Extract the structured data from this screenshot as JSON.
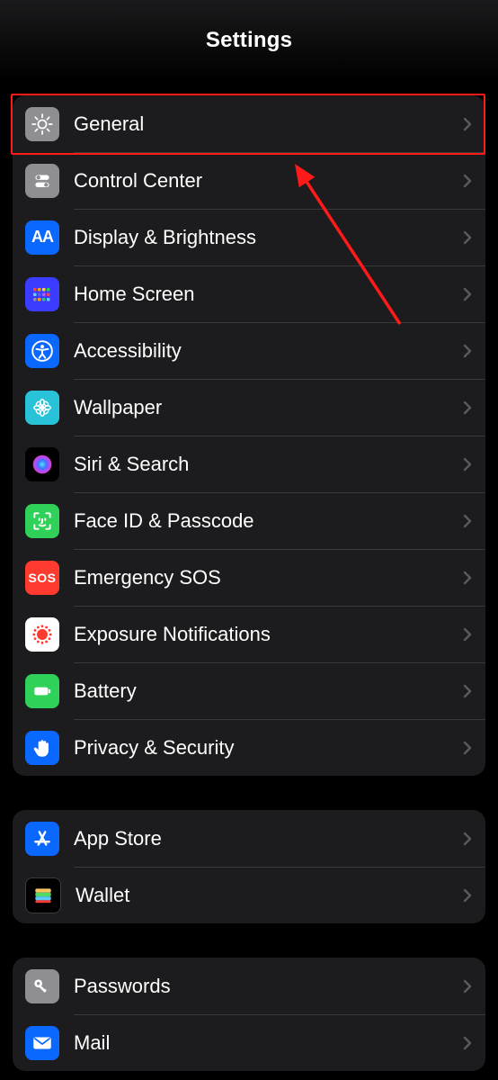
{
  "header": {
    "title": "Settings"
  },
  "groups": [
    {
      "rows": [
        {
          "name": "general",
          "label": "General",
          "icon": "gear",
          "bg": "#8e8e93"
        },
        {
          "name": "control-center",
          "label": "Control Center",
          "icon": "switches",
          "bg": "#8e8e93"
        },
        {
          "name": "display-brightness",
          "label": "Display & Brightness",
          "icon": "aa",
          "bg": "#0a68ff"
        },
        {
          "name": "home-screen",
          "label": "Home Screen",
          "icon": "apps-grid",
          "bg": "#3a3cff"
        },
        {
          "name": "accessibility",
          "label": "Accessibility",
          "icon": "accessibility",
          "bg": "#0a68ff"
        },
        {
          "name": "wallpaper",
          "label": "Wallpaper",
          "icon": "flower",
          "bg": "#28c3d8"
        },
        {
          "name": "siri-search",
          "label": "Siri & Search",
          "icon": "siri",
          "bg": "#000000"
        },
        {
          "name": "face-id-passcode",
          "label": "Face ID & Passcode",
          "icon": "faceid",
          "bg": "#30d158"
        },
        {
          "name": "emergency-sos",
          "label": "Emergency SOS",
          "icon": "sos",
          "bg": "#ff3b30"
        },
        {
          "name": "exposure-notifications",
          "label": "Exposure Notifications",
          "icon": "exposure",
          "bg": "#ffffff"
        },
        {
          "name": "battery",
          "label": "Battery",
          "icon": "battery",
          "bg": "#30d158"
        },
        {
          "name": "privacy-security",
          "label": "Privacy & Security",
          "icon": "hand",
          "bg": "#0a68ff"
        }
      ]
    },
    {
      "rows": [
        {
          "name": "app-store",
          "label": "App Store",
          "icon": "appstore",
          "bg": "#0a68ff"
        },
        {
          "name": "wallet",
          "label": "Wallet",
          "icon": "wallet",
          "bg": "#000000"
        }
      ]
    },
    {
      "rows": [
        {
          "name": "passwords",
          "label": "Passwords",
          "icon": "key",
          "bg": "#8e8e93"
        },
        {
          "name": "mail",
          "label": "Mail",
          "icon": "mail",
          "bg": "#0a68ff"
        }
      ]
    }
  ],
  "annotation": {
    "highlight_target": "general",
    "highlight_color": "#ff1a1a",
    "arrow_color": "#ff1a1a"
  }
}
